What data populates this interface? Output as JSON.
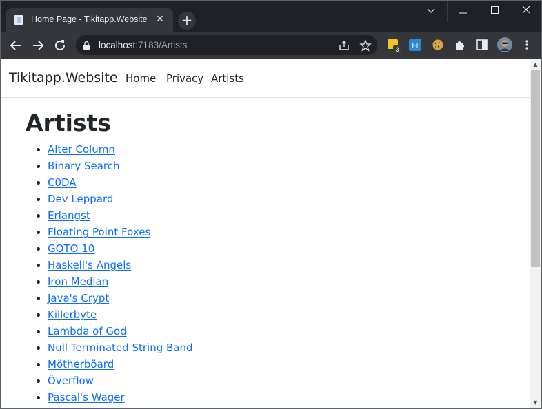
{
  "browser": {
    "tab": {
      "title": "Home Page - Tikitapp.Website",
      "close_icon": "close-icon",
      "favicon": "document-icon"
    },
    "new_tab_label": "+",
    "window_controls": [
      "chevron-down-icon",
      "minimize-icon",
      "maximize-icon",
      "close-icon"
    ],
    "address": {
      "host": "localhost",
      "path": ":7183/Artists",
      "secure_icon": "lock-icon"
    },
    "extensions": [
      {
        "name": "extension-badge-icon",
        "badge": "3",
        "color": "#f2c523"
      },
      {
        "name": "extension-fi-icon",
        "label": "FI",
        "color": "#2b8ad8"
      },
      {
        "name": "cookie-icon",
        "color": "#d9a54a"
      },
      {
        "name": "puzzle-icon"
      },
      {
        "name": "sidebar-icon"
      },
      {
        "name": "avatar"
      },
      {
        "name": "more-menu-icon"
      }
    ]
  },
  "site": {
    "brand": "Tikitapp.Website",
    "nav": [
      {
        "label": "Home"
      },
      {
        "label": "Privacy"
      },
      {
        "label": "Artists"
      }
    ]
  },
  "page": {
    "title": "Artists",
    "artists": [
      "Alter Column",
      "Binary Search",
      "C0DA",
      "Dev Leppard",
      "Erlangst",
      "Floating Point Foxes",
      "GOTO 10",
      "Haskell's Angels",
      "Iron Median",
      "Java's Crypt",
      "Killerbyte",
      "Lambda of God",
      "Null Terminated String Band",
      "Mötherböard",
      "Överflow",
      "Pascal's Wager"
    ]
  },
  "colors": {
    "link": "#0d6efd",
    "chrome_dark": "#202124",
    "chrome_toolbar": "#35363a"
  }
}
